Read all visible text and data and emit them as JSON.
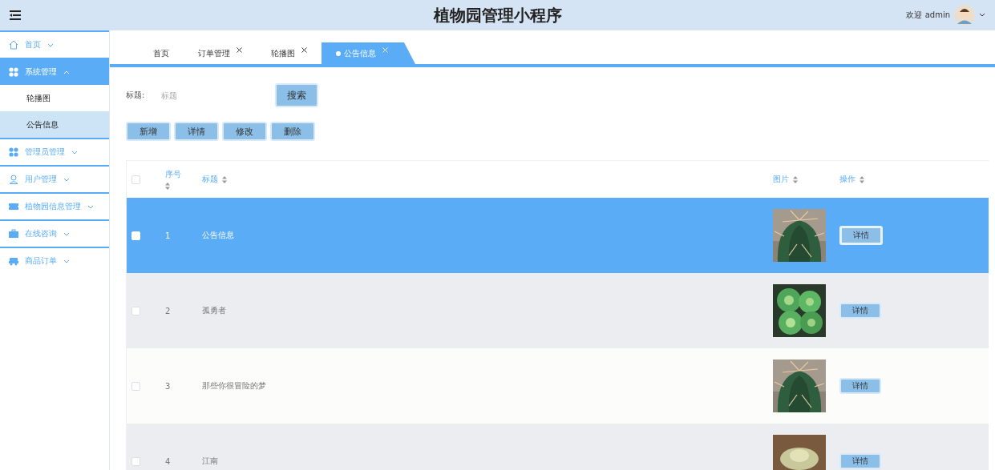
{
  "header": {
    "title": "植物园管理小程序",
    "greeting": "欢迎 admin"
  },
  "sidebar": {
    "items": [
      {
        "label": "首页",
        "expanded": false,
        "selected": false
      },
      {
        "label": "系统管理",
        "expanded": true,
        "selected": true,
        "children": [
          {
            "label": "轮播图",
            "selected": false
          },
          {
            "label": "公告信息",
            "selected": true
          }
        ]
      },
      {
        "label": "管理员管理",
        "expanded": false,
        "selected": false
      },
      {
        "label": "用户管理",
        "expanded": false,
        "selected": false
      },
      {
        "label": "植物园信息管理",
        "expanded": false,
        "selected": false
      },
      {
        "label": "在线咨询",
        "expanded": false,
        "selected": false
      },
      {
        "label": "商品订单",
        "expanded": false,
        "selected": false
      }
    ]
  },
  "tabs": [
    {
      "label": "首页",
      "closable": false,
      "selected": false
    },
    {
      "label": "订单管理",
      "closable": true,
      "selected": false
    },
    {
      "label": "轮播图",
      "closable": true,
      "selected": false
    },
    {
      "label": "公告信息",
      "closable": true,
      "selected": true
    }
  ],
  "search": {
    "label": "标题:",
    "placeholder": "标题",
    "button": "搜索"
  },
  "actions": [
    "新增",
    "详情",
    "修改",
    "删除"
  ],
  "table": {
    "select_all": {
      "checked": false
    },
    "columns": [
      {
        "label": "序号"
      },
      {
        "label": "标题"
      },
      {
        "label": "图片"
      },
      {
        "label": "操作"
      }
    ],
    "rows": [
      {
        "index": "1",
        "title": "公告信息",
        "selected": true,
        "action": "详情"
      },
      {
        "index": "2",
        "title": "孤勇者",
        "selected": false,
        "action": "详情"
      },
      {
        "index": "3",
        "title": "那些你很冒险的梦",
        "selected": false,
        "action": "详情"
      },
      {
        "index": "4",
        "title": "江南",
        "selected": false,
        "action": "详情"
      }
    ]
  }
}
